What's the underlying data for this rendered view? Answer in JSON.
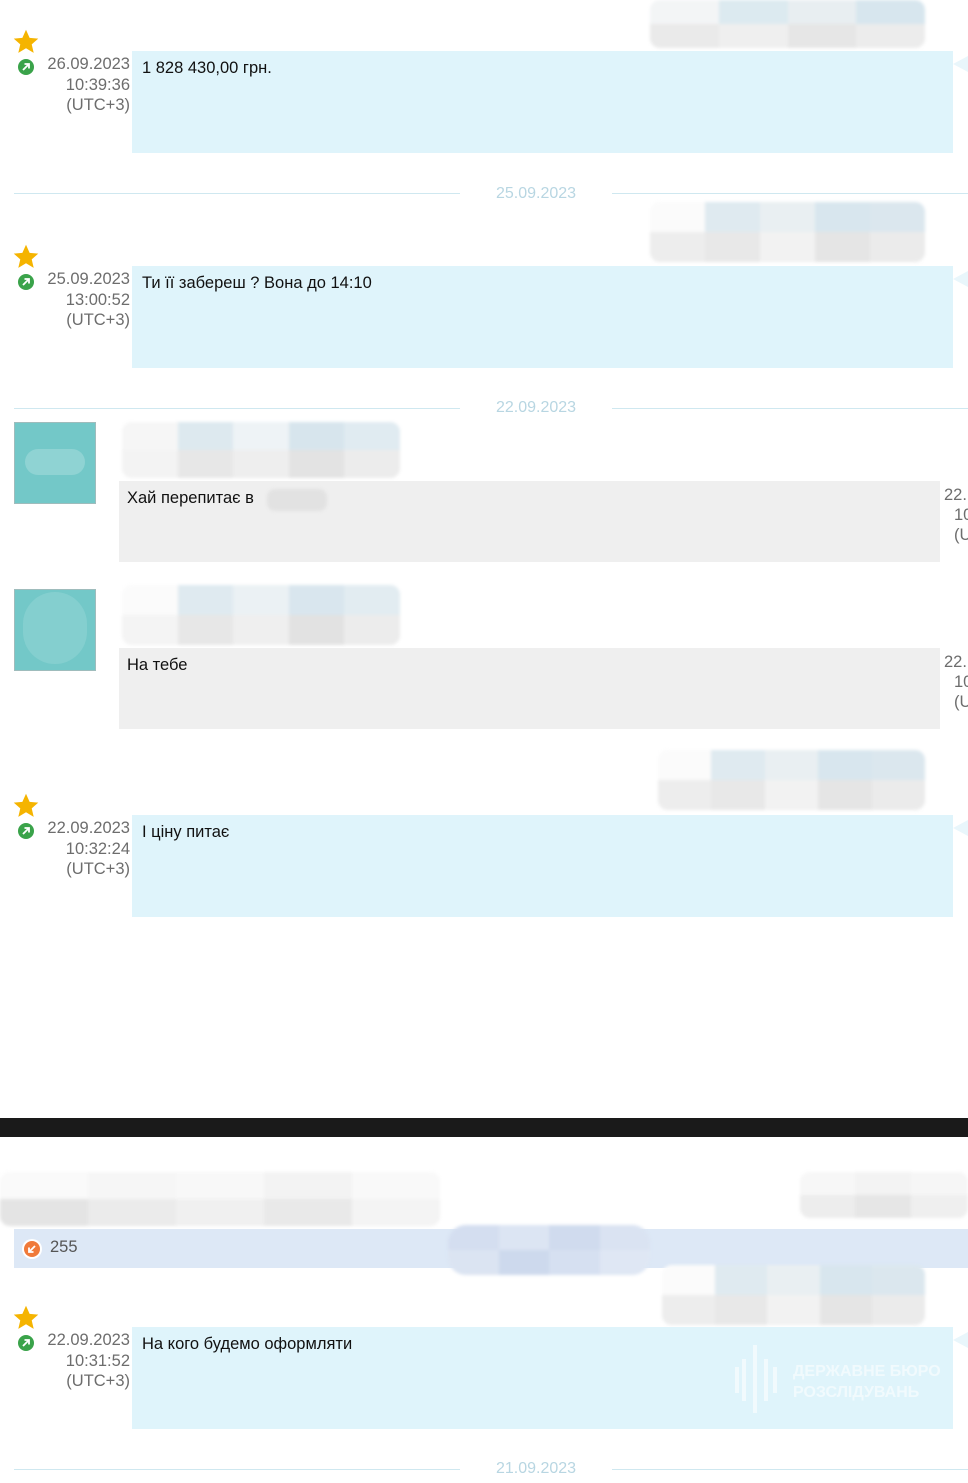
{
  "messages": [
    {
      "date": "26.09.2023",
      "time": "10:39:36",
      "tz": "(UTC+3)",
      "text": "1 828 430,00 грн."
    },
    {
      "date": "25.09.2023",
      "time": "13:00:52",
      "tz": "(UTC+3)",
      "text": "Ти її забереш ? Вона до 14:10"
    },
    {
      "date": "22.09.2023",
      "time": "10:32:24",
      "tz": "(UTC+3)",
      "text": "І ціну питає"
    },
    {
      "date": "22.09.2023",
      "time": "10:31:52",
      "tz": "(UTC+3)",
      "text": "На кого будемо оформляти"
    }
  ],
  "incoming": [
    {
      "text": "Хай перепитає в",
      "ts1": "22.",
      "ts2": "10",
      "ts3": "(U"
    },
    {
      "text": "На тебе",
      "ts1": "22.",
      "ts2": "10",
      "ts3": "(U"
    }
  ],
  "separators": [
    "25.09.2023",
    "22.09.2023",
    "21.09.2023"
  ],
  "counter": {
    "value": "255"
  },
  "watermark": {
    "line1": "ДЕРЖАВНЕ БЮРО",
    "line2": "РОЗСЛІДУВАНЬ"
  },
  "colors": {
    "outgoing_bubble": "#dff4fb",
    "incoming_bubble": "#efefef",
    "star": "#f5b400",
    "sent_icon": "#3aa34a",
    "counter_icon": "#f07a3a"
  }
}
